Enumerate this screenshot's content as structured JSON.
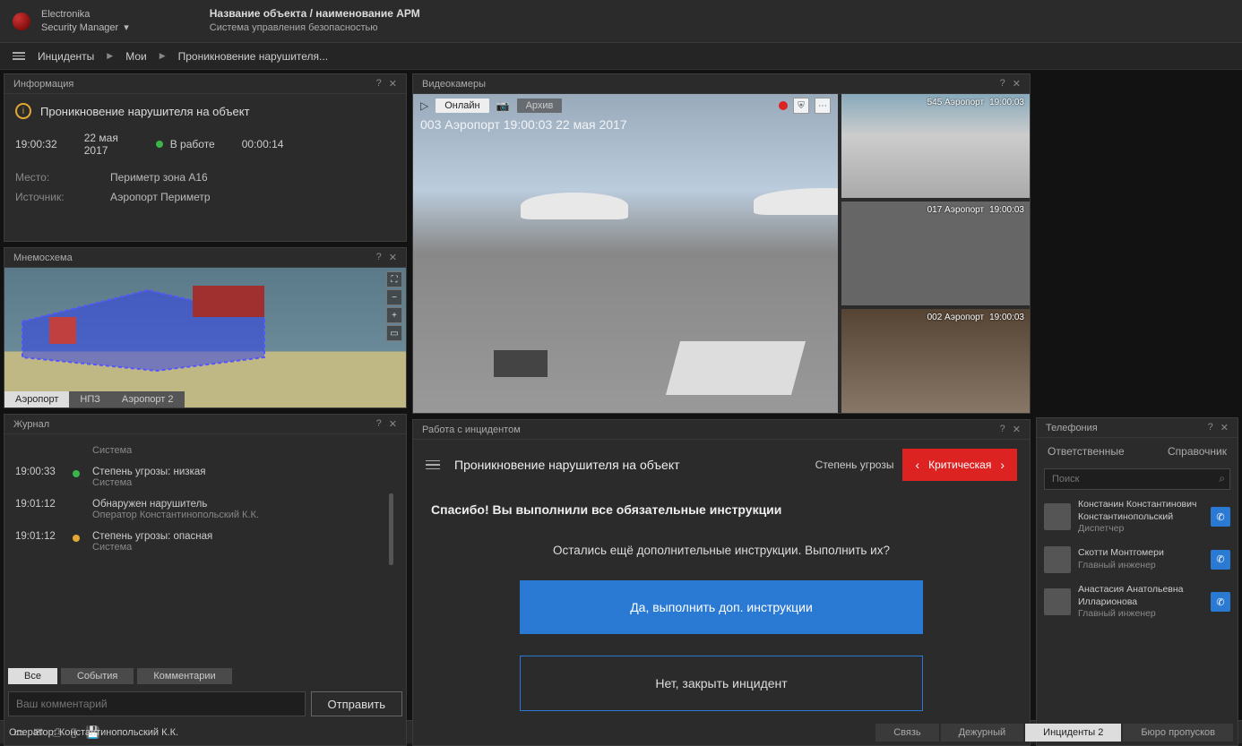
{
  "brand": {
    "line1": "Electronika",
    "line2": "Security Manager"
  },
  "header": {
    "title": "Название объекта / наименование АРМ",
    "subtitle": "Система управления безопасностью"
  },
  "breadcrumb": {
    "item1": "Инциденты",
    "item2": "Мои",
    "item3": "Проникновение нарушителя..."
  },
  "info_panel": {
    "title": "Информация",
    "alert": "Проникновение нарушителя на объект",
    "time": "19:00:32",
    "date": "22 мая 2017",
    "status": "В работе",
    "elapsed": "00:00:14",
    "place_label": "Место:",
    "place_value": "Периметр зона А16",
    "source_label": "Источник:",
    "source_value": "Аэропорт Периметр"
  },
  "mnemo": {
    "title": "Мнемосхема",
    "tab1": "Аэропорт",
    "tab2": "НПЗ",
    "tab3": "Аэропорт 2"
  },
  "journal": {
    "title": "Журнал",
    "row0_text": "Система",
    "row1_time": "19:00:33",
    "row1_text": "Степень угрозы: низкая",
    "row1_sub": "Система",
    "row2_time": "19:01:12",
    "row2_text": "Обнаружен нарушитель",
    "row2_sub": "Оператор Константинопольский К.К.",
    "row3_time": "19:01:12",
    "row3_text": "Степень угрозы: опасная",
    "row3_sub": "Система",
    "tab_all": "Все",
    "tab_events": "События",
    "tab_comments": "Комментарии",
    "placeholder": "Ваш комментарий",
    "send": "Отправить"
  },
  "video": {
    "title": "Видеокамеры",
    "online": "Онлайн",
    "archive": "Архив",
    "main_overlay": "003 Аэропорт 19:00:03 22 мая 2017",
    "thumb1_name": "545 Аэропорт",
    "thumb1_time": "19:00:03",
    "thumb2_name": "017 Аэропорт",
    "thumb2_time": "19:00:03",
    "thumb3_name": "002 Аэропорт",
    "thumb3_time": "19:00:03"
  },
  "incident": {
    "title": "Работа с инцидентом",
    "name": "Проникновение нарушителя на объект",
    "threat_label": "Степень угрозы",
    "threat_value": "Критическая",
    "thanks": "Спасибо! Вы выполнили все обязательные инструкции",
    "question": "Остались ещё дополнительные инструкции. Выполнить их?",
    "yes": "Да, выполнить доп. инструкции",
    "no": "Нет, закрыть инцидент"
  },
  "tel": {
    "title": "Телефония",
    "tab1": "Ответственные",
    "tab2": "Справочник",
    "search": "Поиск",
    "c1_name": "Констанин Константинович Константинопольский",
    "c1_role": "Диспетчер",
    "c2_name": "Скотти Монтгомери",
    "c2_role": "Главный инженер",
    "c3_name": "Анастасия Анатольевна Илларионова",
    "c3_role": "Главный инженер"
  },
  "footer": {
    "operator": "Оператор: Константинопольский К.К.",
    "tab1": "Связь",
    "tab2": "Дежурный",
    "tab3": "Инциденты 2",
    "tab4": "Бюро пропусков"
  }
}
